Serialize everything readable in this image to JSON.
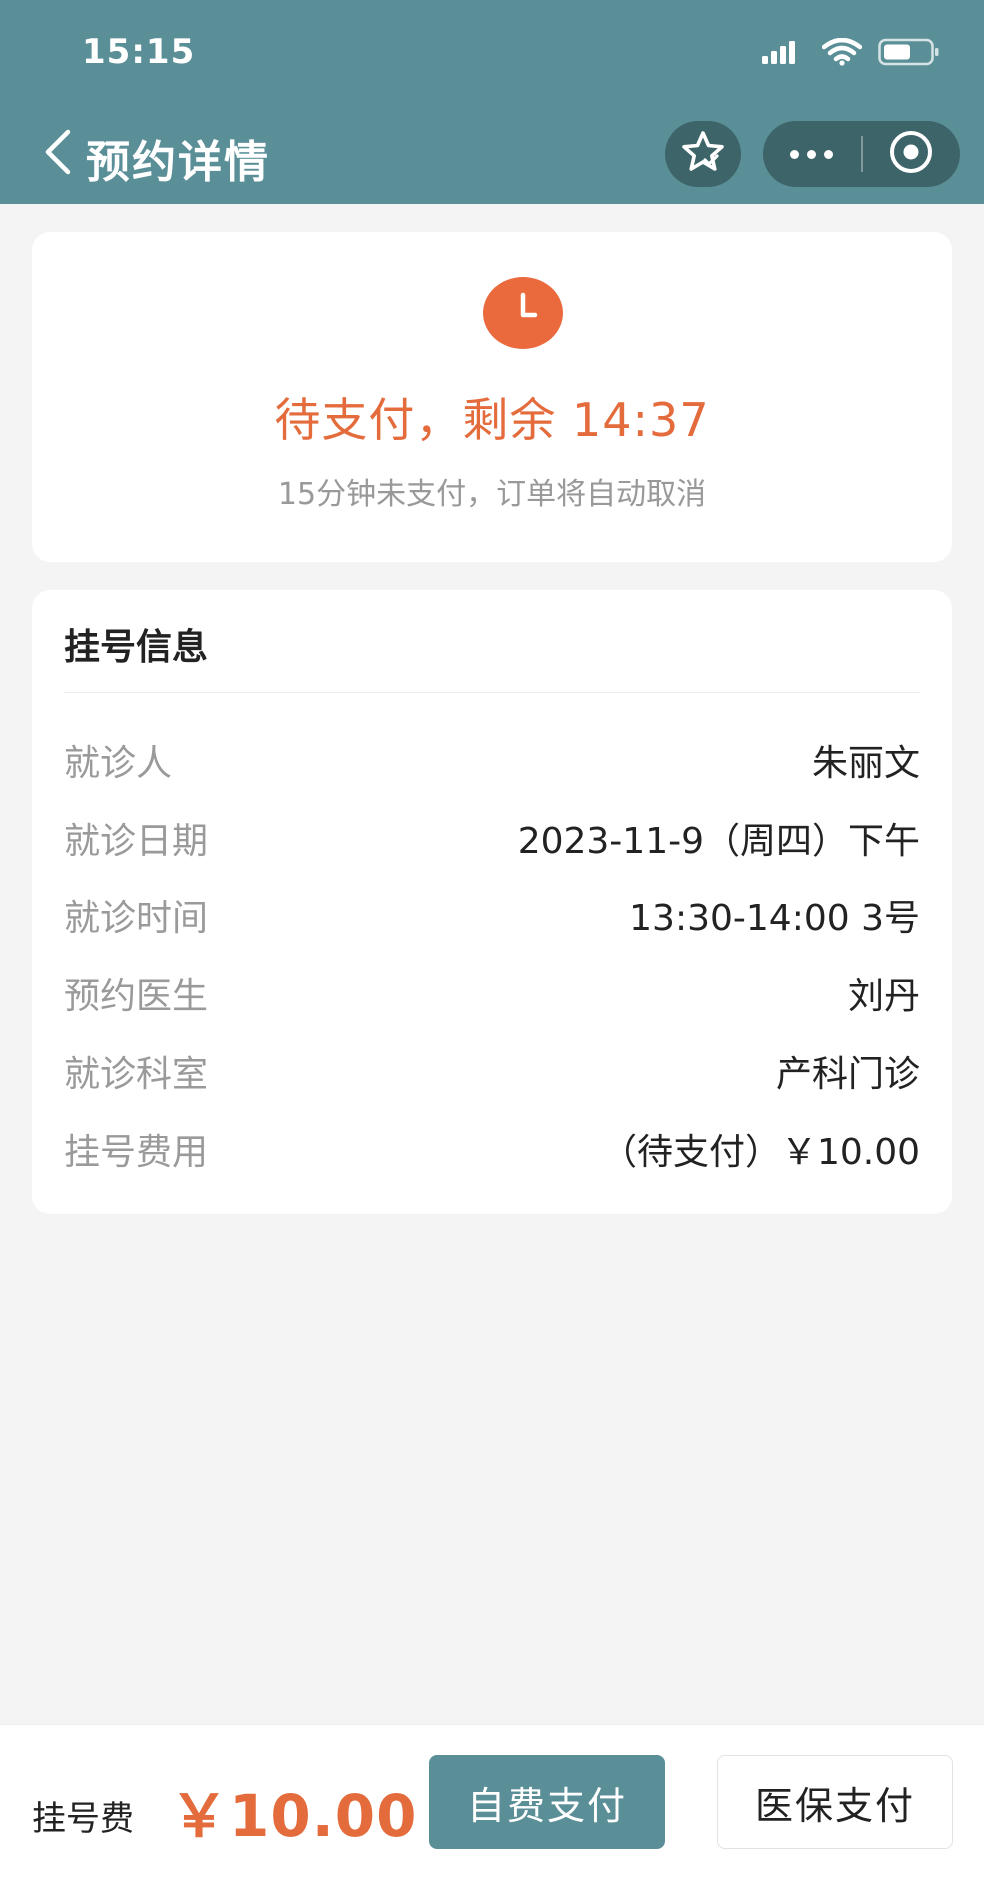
{
  "status_bar": {
    "time": "15:15",
    "icons": [
      "signal-icon",
      "wifi-icon",
      "battery-icon"
    ]
  },
  "nav": {
    "title": "预约详情",
    "icons": [
      "back-icon",
      "favorite-star-icon",
      "more-icon",
      "close-circle-icon"
    ]
  },
  "status_card": {
    "icon": "clock-icon",
    "countdown": "待支付，剩余 14:37",
    "notice": "15分钟未支付，订单将自动取消"
  },
  "info": {
    "title": "挂号信息",
    "rows": [
      {
        "label": "就诊人",
        "value": "朱丽文"
      },
      {
        "label": "就诊日期",
        "value": "2023-11-9（周四）下午"
      },
      {
        "label": "就诊时间",
        "value": "13:30-14:00 3号"
      },
      {
        "label": "预约医生",
        "value": "刘丹"
      },
      {
        "label": "就诊科室",
        "value": "产科门诊"
      },
      {
        "label": "挂号费用",
        "value": "（待支付）￥10.00"
      }
    ]
  },
  "bottom": {
    "fee_label": "挂号费",
    "fee_amount": "￥10.00",
    "self_pay_label": "自费支付",
    "insurance_pay_label": "医保支付"
  },
  "colors": {
    "header": "#5b8f98",
    "accent": "#e46b3c",
    "page_bg": "#f4f4f4",
    "capsule": "#3d6468"
  }
}
